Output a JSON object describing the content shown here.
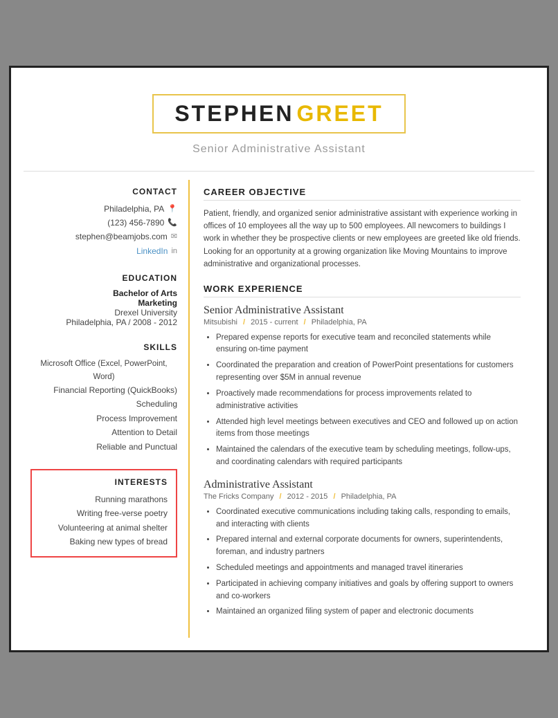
{
  "header": {
    "first_name": "STEPHEN",
    "last_name": "GREET",
    "subtitle": "Senior Administrative Assistant"
  },
  "sidebar": {
    "contact_title": "CONTACT",
    "city": "Philadelphia, PA",
    "phone": "(123) 456-7890",
    "email": "stephen@beamjobs.com",
    "linkedin_label": "LinkedIn",
    "education_title": "EDUCATION",
    "degree": "Bachelor of Arts",
    "major": "Marketing",
    "university": "Drexel University",
    "edu_location": "Philadelphia, PA",
    "edu_years": "2008 - 2012",
    "skills_title": "SKILLS",
    "skills": [
      "Microsoft Office (Excel, PowerPoint, Word)",
      "Financial Reporting (QuickBooks)",
      "Scheduling",
      "Process Improvement",
      "Attention to Detail",
      "Reliable and Punctual"
    ],
    "interests_title": "INTERESTS",
    "interests": [
      "Running marathons",
      "Writing free-verse poetry",
      "Volunteering at animal shelter",
      "Baking new types of bread"
    ]
  },
  "main": {
    "career_objective_title": "CAREER OBJECTIVE",
    "career_objective": "Patient, friendly, and organized senior administrative assistant with experience working in offices of 10 employees all the way up to 500 employees. All newcomers to buildings I work in whether they be prospective clients or new employees are greeted like old friends. Looking for an opportunity at a growing organization like Moving Mountains to improve administrative and organizational processes.",
    "work_experience_title": "WORK EXPERIENCE",
    "jobs": [
      {
        "title": "Senior Administrative Assistant",
        "company": "Mitsubishi",
        "years": "2015 - current",
        "location": "Philadelphia, PA",
        "bullets": [
          "Prepared expense reports for executive team and reconciled statements while ensuring on-time payment",
          "Coordinated the preparation and creation of PowerPoint presentations for customers representing over $5M in annual revenue",
          "Proactively made recommendations for process improvements related to administrative activities",
          "Attended high level meetings between executives and CEO and followed up on action items from those meetings",
          "Maintained the calendars of the executive team by scheduling meetings, follow-ups, and coordinating calendars with required participants"
        ]
      },
      {
        "title": "Administrative Assistant",
        "company": "The Fricks Company",
        "years": "2012 - 2015",
        "location": "Philadelphia, PA",
        "bullets": [
          "Coordinated executive communications including taking calls, responding to emails, and interacting with clients",
          "Prepared internal and external corporate documents for owners, superintendents, foreman, and industry partners",
          "Scheduled meetings and appointments and managed travel itineraries",
          "Participated in achieving company initiatives and goals by offering support to owners and co-workers",
          "Maintained an organized filing system of paper and electronic documents"
        ]
      }
    ]
  }
}
